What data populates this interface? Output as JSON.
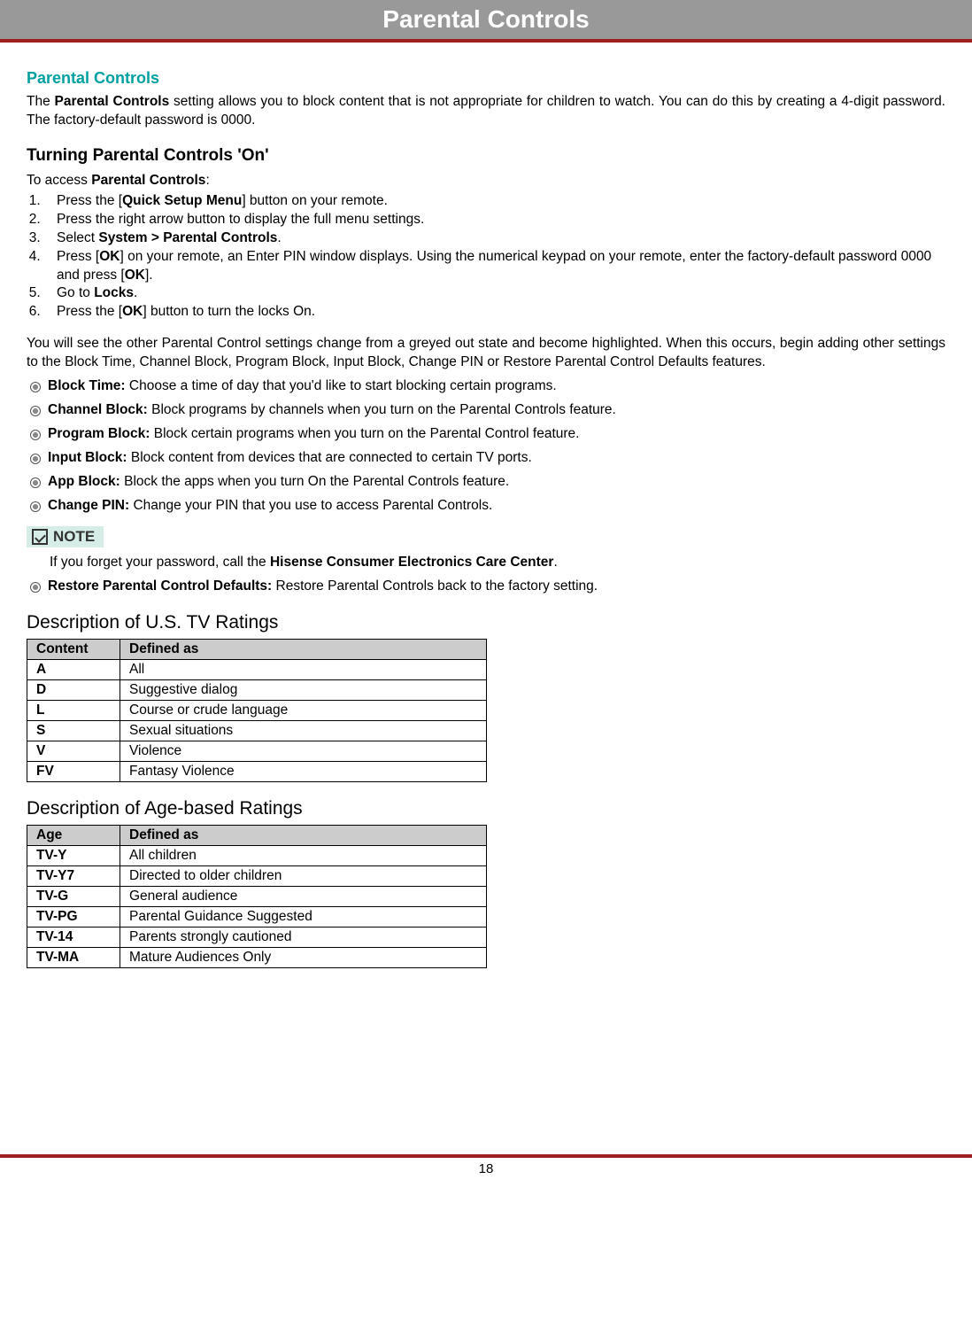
{
  "header": {
    "title": "Parental Controls"
  },
  "sectionTitle": "Parental Controls",
  "intro": {
    "prefix": "The ",
    "bold1": "Parental Controls",
    "suffix": " setting allows you to block content that is not appropriate for children to watch. You can do this by creating a 4-digit password. The factory-default password is 0000."
  },
  "turningOn": {
    "heading": "Turning Parental Controls 'On'",
    "accessPrefix": "To access ",
    "accessBold": "Parental Controls",
    "accessSuffix": ":",
    "steps": [
      {
        "pre": "Press the [",
        "b": "Quick Setup Menu",
        "post": "] button on your remote."
      },
      {
        "pre": "Press the right arrow button to display the full menu settings.",
        "b": "",
        "post": ""
      },
      {
        "pre": "Select ",
        "b": "System > Parental Controls",
        "post": "."
      },
      {
        "pre": "Press [",
        "b": "OK",
        "post": "] on your remote, an Enter PIN window displays. Using the numerical keypad on your remote, enter the factory-default password 0000 and press [",
        "b2": "OK",
        "post2": "]."
      },
      {
        "pre": "Go to ",
        "b": "Locks",
        "post": "."
      },
      {
        "pre": "Press the [",
        "b": "OK",
        "post": "] button to turn the locks On."
      }
    ],
    "afterSteps": "You will see the other Parental Control settings change from a greyed out state and become highlighted. When this occurs, begin adding other settings to the Block Time, Channel Block, Program Block, Input Block, Change PIN or Restore Parental Control Defaults features."
  },
  "features": [
    {
      "label": "Block Time:",
      "desc": " Choose a time of day that you'd like to start blocking certain programs."
    },
    {
      "label": "Channel Block:",
      "desc": " Block programs by channels when you turn on the Parental Controls feature."
    },
    {
      "label": "Program Block:",
      "desc": " Block certain programs when you turn on the Parental Control feature."
    },
    {
      "label": "Input Block:",
      "desc": " Block content from devices that are connected to certain TV ports."
    },
    {
      "label": "App Block:",
      "desc": " Block the apps when you turn On the Parental Controls feature."
    },
    {
      "label": "Change PIN:",
      "desc": " Change your PIN that you use to access Parental Controls."
    }
  ],
  "note": {
    "label": "NOTE",
    "textPrefix": "If you forget your password, call the ",
    "textBold": "Hisense Consumer Electronics Care Center",
    "textSuffix": "."
  },
  "restore": {
    "label": "Restore Parental Control Defaults:",
    "desc": " Restore Parental Controls back to the factory setting."
  },
  "usTable": {
    "title": "Description of U.S. TV Ratings",
    "headers": [
      "Content",
      "Defined as"
    ],
    "rows": [
      [
        "A",
        "All"
      ],
      [
        "D",
        "Suggestive dialog"
      ],
      [
        "L",
        "Course or crude language"
      ],
      [
        "S",
        "Sexual situations"
      ],
      [
        "V",
        "Violence"
      ],
      [
        "FV",
        "Fantasy Violence"
      ]
    ]
  },
  "ageTable": {
    "title": "Description of Age-based Ratings",
    "headers": [
      "Age",
      "Defined as"
    ],
    "rows": [
      [
        "TV-Y",
        "All children"
      ],
      [
        "TV-Y7",
        "Directed to older children"
      ],
      [
        "TV-G",
        "General audience"
      ],
      [
        "TV-PG",
        "Parental Guidance Suggested"
      ],
      [
        "TV-14",
        "Parents strongly cautioned"
      ],
      [
        "TV-MA",
        "Mature Audiences Only"
      ]
    ]
  },
  "pageNumber": "18"
}
